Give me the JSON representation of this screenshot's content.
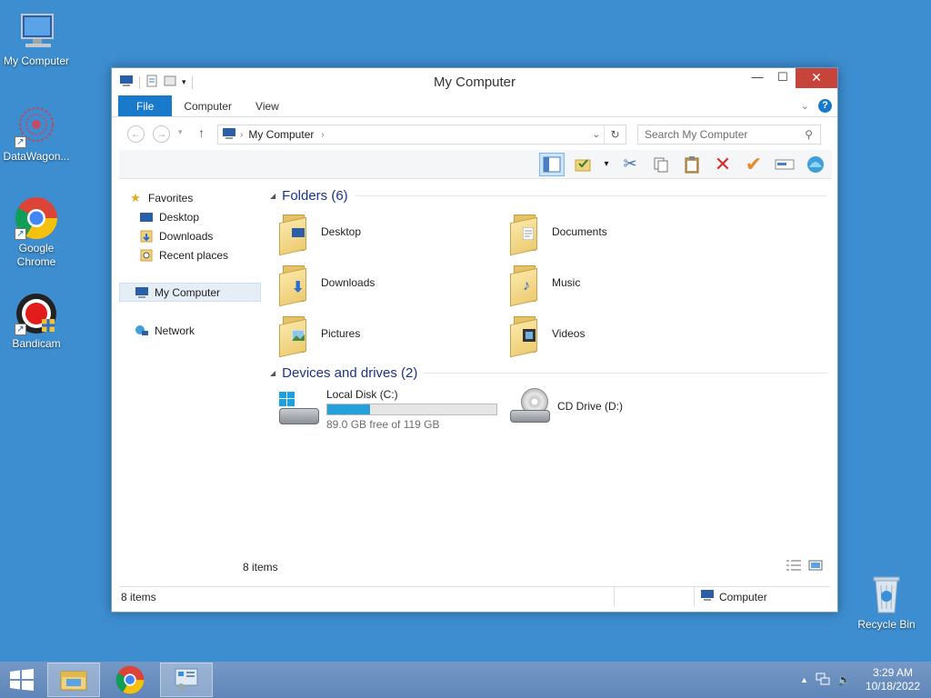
{
  "desktop": {
    "icons": [
      {
        "label": "My Computer"
      },
      {
        "label": "DataWagon..."
      },
      {
        "label": "Google Chrome"
      },
      {
        "label": "Bandicam"
      },
      {
        "label": "Recycle Bin"
      }
    ]
  },
  "window": {
    "title": "My Computer",
    "controls": {
      "minimize": "—",
      "maximize": "☐",
      "close": "✕"
    },
    "ribbon_tabs": [
      {
        "label": "File"
      },
      {
        "label": "Computer"
      },
      {
        "label": "View"
      }
    ],
    "help_label": "?",
    "address": {
      "crumb": "My Computer",
      "separator": "›"
    },
    "search": {
      "placeholder": "Search My Computer"
    },
    "nav": {
      "favorites": "Favorites",
      "desktop": "Desktop",
      "downloads": "Downloads",
      "recent": "Recent places",
      "my_computer": "My Computer",
      "network": "Network"
    },
    "groups": {
      "folders": "Folders (6)",
      "devices": "Devices and drives (2)"
    },
    "folders": [
      {
        "label": "Desktop"
      },
      {
        "label": "Documents"
      },
      {
        "label": "Downloads"
      },
      {
        "label": "Music"
      },
      {
        "label": "Pictures"
      },
      {
        "label": "Videos"
      }
    ],
    "drives": [
      {
        "name": "Local Disk (C:)",
        "free_text": "89.0 GB free of 119 GB",
        "used_fraction": 0.252
      },
      {
        "name": "CD Drive (D:)"
      }
    ],
    "item_count": "8 items",
    "status": {
      "items": "8 items",
      "location": "Computer"
    }
  },
  "taskbar": {
    "time": "3:29 AM",
    "date": "10/18/2022"
  },
  "colors": {
    "accent": "#1979ca",
    "desktop": "#3d8ed1",
    "close": "#c7443a",
    "progress": "#26a0da"
  }
}
